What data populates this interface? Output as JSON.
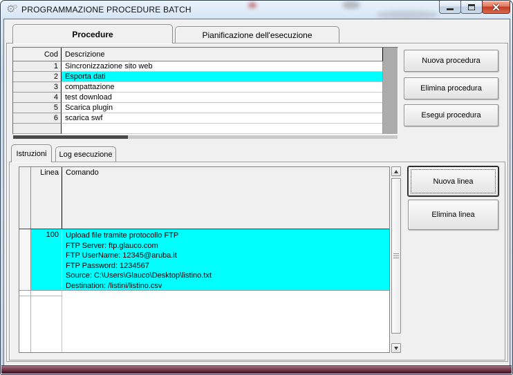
{
  "window": {
    "title": "PROGRAMMAZIONE PROCEDURE BATCH"
  },
  "main_tabs": {
    "procedure": "Procedure",
    "pianificazione": "Pianificazione dell'esecuzione"
  },
  "procedures": {
    "col_cod": "Cod",
    "col_descrizione": "Descrizione",
    "rows": [
      {
        "cod": "1",
        "desc": "Sincronizzazione sito web"
      },
      {
        "cod": "2",
        "desc": "Esporta dati"
      },
      {
        "cod": "3",
        "desc": "compattazione"
      },
      {
        "cod": "4",
        "desc": "test download"
      },
      {
        "cod": "5",
        "desc": "Scarica plugin"
      },
      {
        "cod": "6",
        "desc": "scarica swf"
      }
    ],
    "selected_cod": "2"
  },
  "procedure_buttons": {
    "nuova": "Nuova procedura",
    "elimina": "Elimina procedura",
    "esegui": "Esegui procedura"
  },
  "sub_tabs": {
    "istruzioni": "Istruzioni",
    "log": "Log esecuzione"
  },
  "instructions": {
    "col_linea": "Linea",
    "col_comando": "Comando",
    "selected_row": {
      "linea": "100",
      "comando": [
        "Upload file tramite protocollo FTP",
        "FTP Server: ftp.glauco.com",
        "FTP UserName: 12345@aruba.it",
        "FTP Password: 1234567",
        "Source: C:\\Users\\Glauco\\Desktop\\listino.txt",
        "Destination: /listini/listino.csv"
      ]
    }
  },
  "line_buttons": {
    "nuova": "Nuova linea",
    "elimina": "Elimina linea"
  },
  "colors": {
    "selection": "#00ffff",
    "titlebar_glass": "#c6d8ec",
    "close_button": "#c23f27",
    "bottom_border": "#6d3547"
  }
}
